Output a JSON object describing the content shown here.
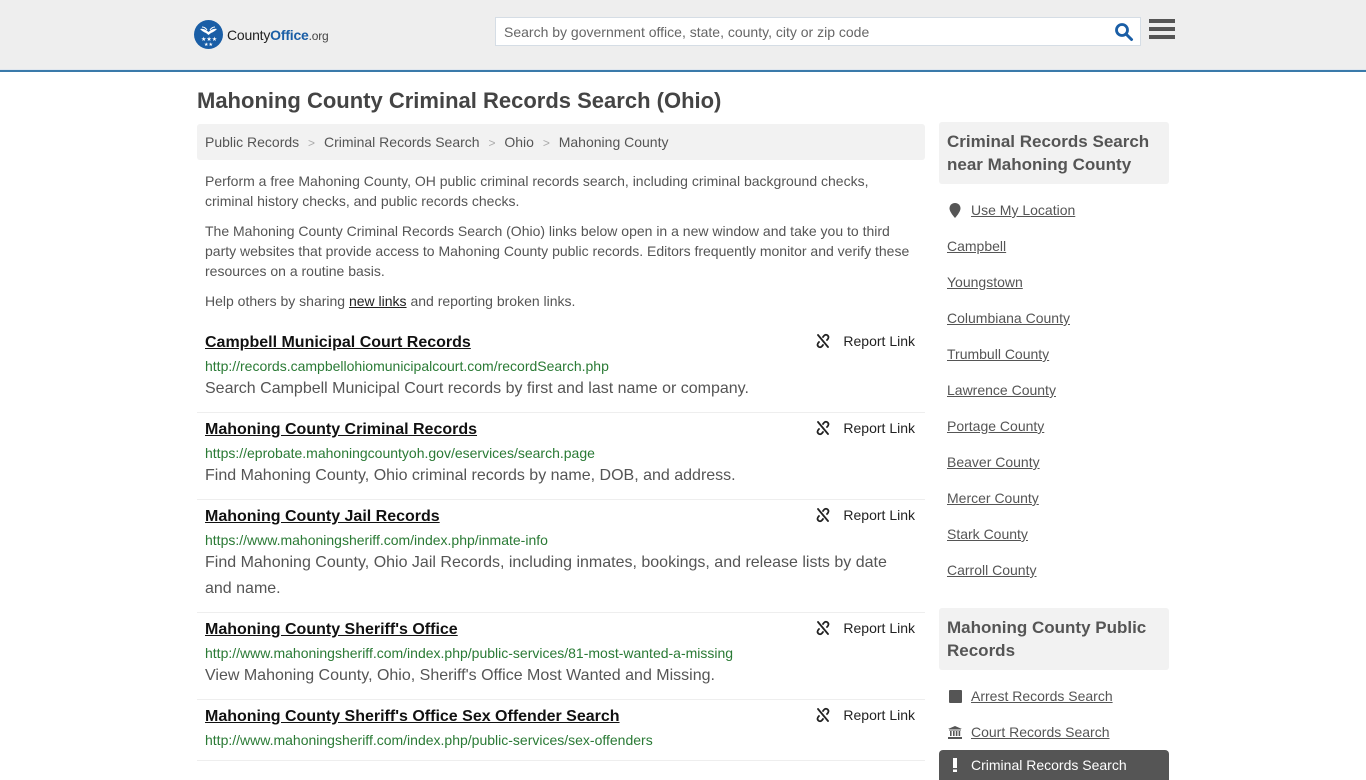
{
  "header": {
    "logo": {
      "county": "County",
      "office": "Office",
      "org": ".org"
    },
    "search_placeholder": "Search by government office, state, county, city or zip code",
    "search_value": "",
    "brand_color": "#1a5ea6",
    "accent_border": "#3a7aaa"
  },
  "page": {
    "title": "Mahoning County Criminal Records Search (Ohio)"
  },
  "breadcrumb": [
    {
      "label": "Public Records"
    },
    {
      "label": "Criminal Records Search"
    },
    {
      "label": "Ohio"
    },
    {
      "label": "Mahoning County"
    }
  ],
  "intro": {
    "p1": "Perform a free Mahoning County, OH public criminal records search, including criminal background checks, criminal history checks, and public records checks.",
    "p2": "The Mahoning County Criminal Records Search (Ohio) links below open in a new window and take you to third party websites that provide access to Mahoning County public records. Editors frequently monitor and verify these resources on a routine basis.",
    "p3_before": "Help others by sharing ",
    "p3_link": "new links",
    "p3_after": " and reporting broken links."
  },
  "report_label": "Report Link",
  "results": [
    {
      "title": "Campbell Municipal Court Records",
      "url": "http://records.campbellohiomunicipalcourt.com/recordSearch.php",
      "desc": "Search Campbell Municipal Court records by first and last name or company."
    },
    {
      "title": "Mahoning County Criminal Records",
      "url": "https://eprobate.mahoningcountyoh.gov/eservices/search.page",
      "desc": "Find Mahoning County, Ohio criminal records by name, DOB, and address."
    },
    {
      "title": "Mahoning County Jail Records",
      "url": "https://www.mahoningsheriff.com/index.php/inmate-info",
      "desc": "Find Mahoning County, Ohio Jail Records, including inmates, bookings, and release lists by date and name."
    },
    {
      "title": "Mahoning County Sheriff's Office",
      "url": "http://www.mahoningsheriff.com/index.php/public-services/81-most-wanted-a-missing",
      "desc": "View Mahoning County, Ohio, Sheriff's Office Most Wanted and Missing."
    },
    {
      "title": "Mahoning County Sheriff's Office Sex Offender Search",
      "url": "http://www.mahoningsheriff.com/index.php/public-services/sex-offenders",
      "desc": ""
    }
  ],
  "sidebar": {
    "nearby_heading": "Criminal Records Search near Mahoning County",
    "use_location": "Use My Location",
    "nearby": [
      "Campbell",
      "Youngstown",
      "Columbiana County",
      "Trumbull County",
      "Lawrence County",
      "Portage County",
      "Beaver County",
      "Mercer County",
      "Stark County",
      "Carroll County"
    ],
    "public_heading": "Mahoning County Public Records",
    "public_records": [
      {
        "label": "Arrest Records Search",
        "icon": "square-icon"
      },
      {
        "label": "Court Records Search",
        "icon": "courthouse-icon"
      }
    ],
    "active_item": {
      "label": "Criminal Records Search",
      "icon": "exclamation-icon"
    }
  }
}
